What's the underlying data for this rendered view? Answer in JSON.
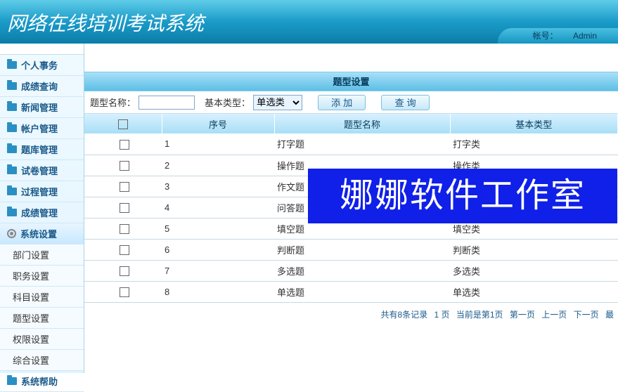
{
  "header": {
    "title": "网络在线培训考试系统",
    "account_label": "帐号：",
    "account_user": "Admin"
  },
  "sidebar": {
    "items": [
      {
        "label": "个人事务",
        "type": "main"
      },
      {
        "label": "成绩查询",
        "type": "main"
      },
      {
        "label": "新闻管理",
        "type": "main"
      },
      {
        "label": "帐户管理",
        "type": "main"
      },
      {
        "label": "题库管理",
        "type": "main"
      },
      {
        "label": "试卷管理",
        "type": "main"
      },
      {
        "label": "过程管理",
        "type": "main"
      },
      {
        "label": "成绩管理",
        "type": "main"
      },
      {
        "label": "系统设置",
        "type": "main-active"
      },
      {
        "label": "部门设置",
        "type": "sub"
      },
      {
        "label": "职务设置",
        "type": "sub"
      },
      {
        "label": "科目设置",
        "type": "sub"
      },
      {
        "label": "题型设置",
        "type": "sub"
      },
      {
        "label": "权限设置",
        "type": "sub"
      },
      {
        "label": "综合设置",
        "type": "sub"
      },
      {
        "label": "系统帮助",
        "type": "main"
      }
    ]
  },
  "panel": {
    "title": "题型设置"
  },
  "filter": {
    "name_label": "题型名称：",
    "name_value": "",
    "type_label": "基本类型：",
    "type_selected": "单选类",
    "add_btn": "添 加",
    "query_btn": "查  询"
  },
  "table": {
    "headers": {
      "seq": "序号",
      "name": "题型名称",
      "type": "基本类型"
    },
    "rows": [
      {
        "seq": "1",
        "name": "打字题",
        "type": "打字类"
      },
      {
        "seq": "2",
        "name": "操作题",
        "type": "操作类"
      },
      {
        "seq": "3",
        "name": "作文题",
        "type": ""
      },
      {
        "seq": "4",
        "name": "问答题",
        "type": ""
      },
      {
        "seq": "5",
        "name": "填空题",
        "type": "填空类"
      },
      {
        "seq": "6",
        "name": "判断题",
        "type": "判断类"
      },
      {
        "seq": "7",
        "name": "多选题",
        "type": "多选类"
      },
      {
        "seq": "8",
        "name": "单选题",
        "type": "单选类"
      }
    ]
  },
  "pager": {
    "summary1": "共有8条记录",
    "summary2": "1 页",
    "summary3": "当前是第1页",
    "first": "第一页",
    "prev": "上一页",
    "next": "下一页",
    "last": "最"
  },
  "watermark": "娜娜软件工作室"
}
